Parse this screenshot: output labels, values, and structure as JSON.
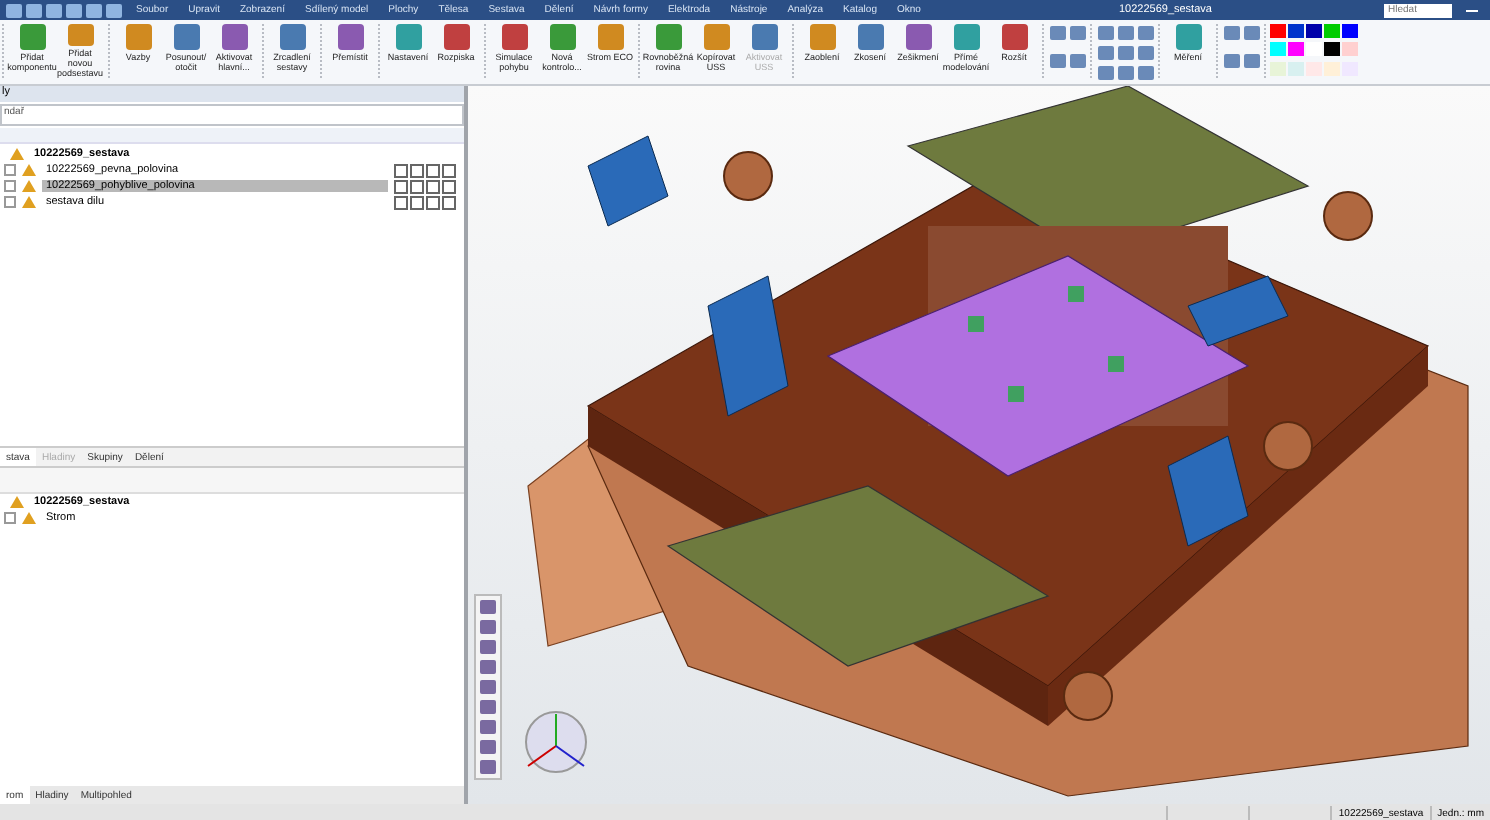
{
  "window": {
    "title": "10222569_sestava",
    "search_placeholder": "Hledat"
  },
  "menu": [
    "Soubor",
    "Upravit",
    "Zobrazení",
    "Sdílený model",
    "Plochy",
    "Tělesa",
    "Sestava",
    "Dělení",
    "Návrh formy",
    "Elektroda",
    "Nástroje",
    "Analýza",
    "Katalog",
    "Okno"
  ],
  "ribbon": [
    {
      "kind": "labeled",
      "buttons": [
        {
          "label": "Přidat komponentu",
          "disabled": false
        },
        {
          "label": "Přidat novou podsestavu",
          "disabled": false
        }
      ]
    },
    {
      "kind": "labeled",
      "buttons": [
        {
          "label": "Vazby",
          "disabled": false
        },
        {
          "label": "Posunout/ otočit",
          "disabled": false
        },
        {
          "label": "Aktivovat hlavní...",
          "disabled": false
        }
      ]
    },
    {
      "kind": "labeled",
      "buttons": [
        {
          "label": "Zrcadlení sestavy",
          "disabled": false
        }
      ]
    },
    {
      "kind": "labeled",
      "buttons": [
        {
          "label": "Přemístit",
          "disabled": false
        }
      ]
    },
    {
      "kind": "labeled",
      "buttons": [
        {
          "label": "Nastavení",
          "disabled": false
        },
        {
          "label": "Rozpiska",
          "disabled": false
        }
      ]
    },
    {
      "kind": "labeled",
      "buttons": [
        {
          "label": "Simulace pohybu",
          "disabled": false
        },
        {
          "label": "Nová kontrolo...",
          "disabled": false
        },
        {
          "label": "Strom ECO",
          "disabled": false
        }
      ]
    },
    {
      "kind": "labeled",
      "buttons": [
        {
          "label": "Rovnoběžná rovina",
          "disabled": false
        },
        {
          "label": "Kopírovat USS",
          "disabled": false
        },
        {
          "label": "Aktivovat USS",
          "disabled": true
        }
      ]
    },
    {
      "kind": "labeled",
      "buttons": [
        {
          "label": "Zaoblení",
          "disabled": false
        },
        {
          "label": "Zkosení",
          "disabled": false
        },
        {
          "label": "Zešikmení",
          "disabled": false
        },
        {
          "label": "Přímé modelování",
          "disabled": false
        },
        {
          "label": "Rozšít",
          "disabled": false
        }
      ]
    },
    {
      "kind": "icons"
    },
    {
      "kind": "icons_grid"
    },
    {
      "kind": "labeled",
      "buttons": [
        {
          "label": "Měření",
          "disabled": false
        }
      ]
    },
    {
      "kind": "icons"
    },
    {
      "kind": "palette",
      "swatches": [
        {
          "color": "#ff0000"
        },
        {
          "color": "#0033cc"
        },
        {
          "color": "#0000aa"
        },
        {
          "color": "#00cc00"
        },
        {
          "color": "#0000ff"
        },
        {
          "color": "#00ffff"
        },
        {
          "color": "#ff00ff"
        },
        {
          "color": "#ffffff"
        },
        {
          "color": "#000000"
        },
        {
          "color": "#ffd0d0"
        },
        {
          "color": "#e8f4d8"
        },
        {
          "color": "#d8f0f0"
        },
        {
          "color": "#ffe8e8"
        },
        {
          "color": "#fff0d8"
        },
        {
          "color": "#f0e8ff"
        }
      ]
    }
  ],
  "left_panel": {
    "title": "ly",
    "filter": "ndař",
    "tree": [
      {
        "label": "10222569_sestava",
        "selected": false,
        "children": [
          {
            "label": "10222569_pevna_polovina",
            "selected": false
          },
          {
            "label": "10222569_pohyblive_polovina",
            "selected": true
          },
          {
            "label": "sestava dilu",
            "selected": false
          }
        ]
      }
    ],
    "tabs": [
      {
        "label": "stava",
        "selected": true
      },
      {
        "label": "Hladiny",
        "selected": false
      },
      {
        "label": "Skupiny",
        "selected": false
      },
      {
        "label": "Dělení",
        "selected": false
      }
    ],
    "tree2": [
      {
        "label": "10222569_sestava",
        "children": [
          {
            "label": "Strom"
          }
        ]
      }
    ],
    "bottom_tabs": [
      {
        "label": "rom",
        "selected": true
      },
      {
        "label": "Hladiny",
        "selected": false
      },
      {
        "label": "Multipohled",
        "selected": false
      }
    ]
  },
  "status_bar": {
    "document": "10222569_sestava",
    "units": "Jedn.: mm"
  }
}
